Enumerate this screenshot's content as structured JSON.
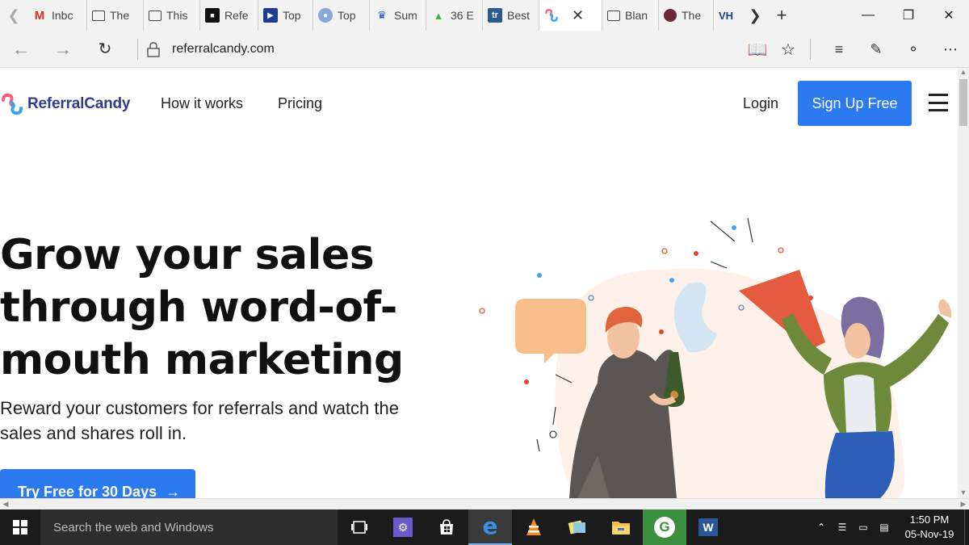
{
  "browser": {
    "tabs": [
      {
        "label": "Inbc",
        "icon": "gmail-icon"
      },
      {
        "label": "The",
        "icon": "page-icon"
      },
      {
        "label": "This",
        "icon": "page-icon"
      },
      {
        "label": "Refe",
        "icon": "referral-icon"
      },
      {
        "label": "Top",
        "icon": "play-icon"
      },
      {
        "label": "Top",
        "icon": "globe-icon"
      },
      {
        "label": "Sum",
        "icon": "crown-icon"
      },
      {
        "label": "36 E",
        "icon": "android-icon"
      },
      {
        "label": "Best",
        "icon": "tr-icon"
      },
      {
        "label": "",
        "icon": "referralcandy-icon",
        "active": true
      },
      {
        "label": "Blan",
        "icon": "page-icon"
      },
      {
        "label": "The",
        "icon": "circle-icon"
      },
      {
        "label": "VH",
        "icon": "vh-icon"
      }
    ],
    "url": "referralcandy.com"
  },
  "site": {
    "brand": "ReferralCandy",
    "nav": [
      "How it works",
      "Pricing"
    ],
    "login": "Login",
    "signup": "Sign Up Free",
    "hero": {
      "title_lines": [
        "Grow your sales",
        "through word-of-",
        "mouth marketing"
      ],
      "subtitle_lines": [
        "Reward your customers for referrals and watch the",
        "sales and shares roll in."
      ],
      "cta": "Try Free for 30 Days",
      "cta_arrow": "→"
    },
    "colors": {
      "accent": "#2b7af0",
      "brand_text": "#2c3e8f"
    }
  },
  "taskbar": {
    "search_placeholder": "Search the web and Windows",
    "time": "1:50 PM",
    "date": "05-Nov-19"
  }
}
